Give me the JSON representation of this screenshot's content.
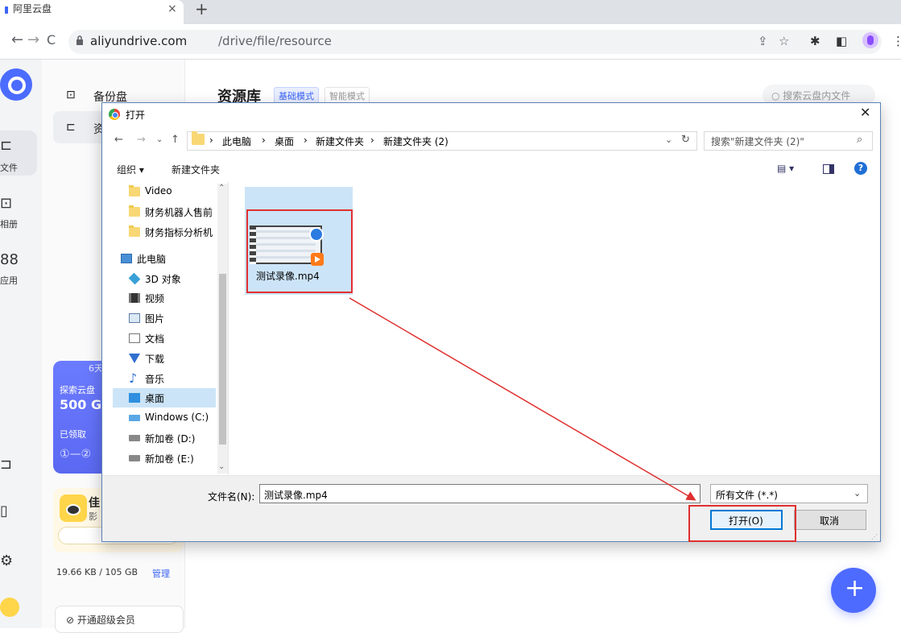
{
  "browser": {
    "tab_title": "阿里云盘",
    "tab_close": "×",
    "new_tab": "+",
    "url_host": "aliyundrive.com",
    "url_path": "/drive/file/resource",
    "icons": [
      "back-icon",
      "forward-icon",
      "reload-icon",
      "share-icon",
      "star-icon",
      "extension-icon",
      "sidepanel-icon",
      "profile-icon",
      "menu-icon"
    ]
  },
  "app": {
    "rail": {
      "file_label": "文件",
      "album_label": "相册",
      "apps_label": "应用"
    },
    "panel": {
      "backup_label": "备份盘",
      "resource_label": "资"
    },
    "promo": {
      "days": "6天",
      "title": "探索云盘",
      "size": "500 G",
      "claimed": "已领取",
      "steps": "①—②"
    },
    "promo2": {
      "title": "佳",
      "sub": "影"
    },
    "storage": {
      "used": "19.66 KB / 105 GB",
      "manage": "管理"
    },
    "vip_label": "开通超级会员",
    "library_title": "资源库",
    "mode_basic": "基础模式",
    "mode_smart": "智能模式",
    "search_placeholder": "搜索云盘内文件",
    "fab_plus": "+",
    "accent_color": "#4e6bff"
  },
  "dialog": {
    "title": "打开",
    "close": "✕",
    "breadcrumbs": [
      "此电脑",
      "桌面",
      "新建文件夹",
      "新建文件夹 (2)"
    ],
    "search_placeholder": "搜索\"新建文件夹 (2)\"",
    "organize": "组织 ▾",
    "new_folder": "新建文件夹",
    "help": "?",
    "nav_items": [
      {
        "label": "Video",
        "icon": "folder-icon"
      },
      {
        "label": "财务机器人售前",
        "icon": "folder-icon"
      },
      {
        "label": "财务指标分析机",
        "icon": "sync-folder-icon"
      },
      {
        "label": "此电脑",
        "icon": "pc-icon"
      },
      {
        "label": "3D 对象",
        "icon": "cube-icon"
      },
      {
        "label": "视频",
        "icon": "video-icon"
      },
      {
        "label": "图片",
        "icon": "picture-icon"
      },
      {
        "label": "文档",
        "icon": "document-icon"
      },
      {
        "label": "下载",
        "icon": "download-icon"
      },
      {
        "label": "音乐",
        "icon": "music-icon"
      },
      {
        "label": "桌面",
        "icon": "desktop-icon"
      },
      {
        "label": "Windows (C:)",
        "icon": "windows-drive-icon"
      },
      {
        "label": "新加卷 (D:)",
        "icon": "drive-icon"
      },
      {
        "label": "新加卷 (E:)",
        "icon": "drive-icon"
      }
    ],
    "selected_nav": "桌面",
    "file": {
      "name": "测试录像.mp4"
    },
    "filename_label": "文件名(N):",
    "filename_value": "测试录像.mp4",
    "filter_value": "所有文件 (*.*)",
    "open_label": "打开(O)",
    "cancel_label": "取消"
  },
  "annotation_color": "#e03030"
}
